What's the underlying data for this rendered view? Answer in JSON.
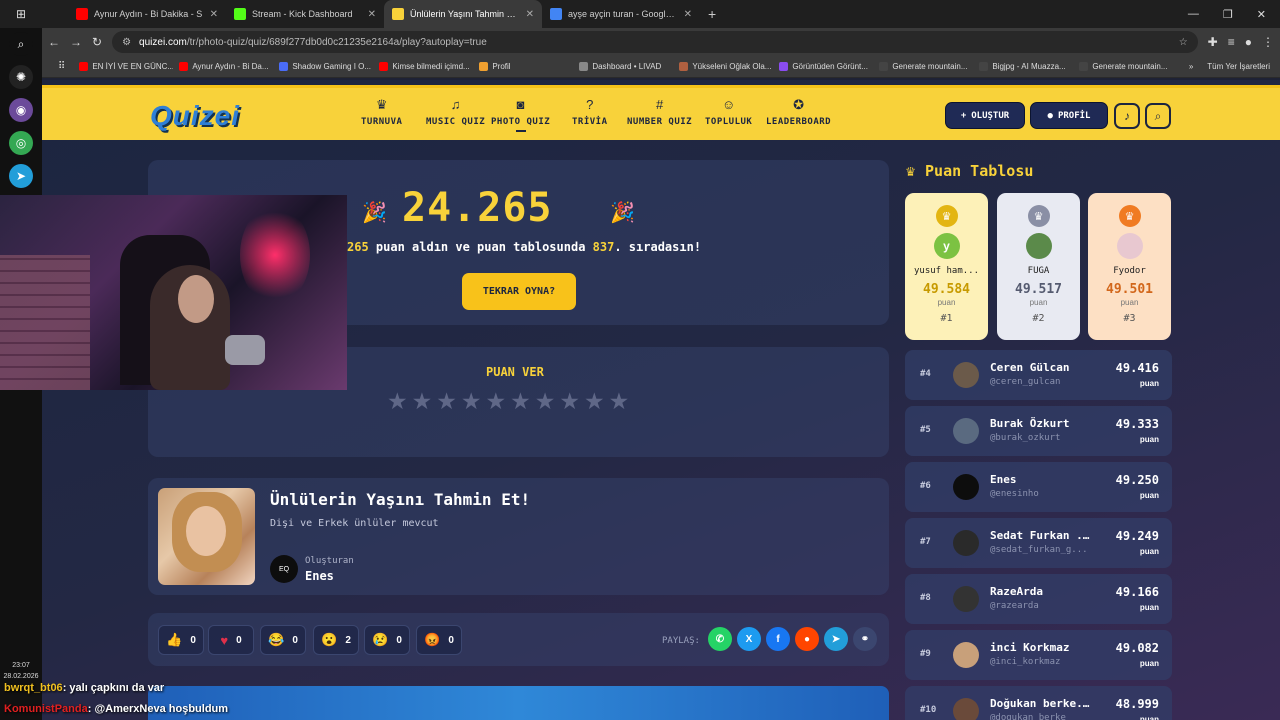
{
  "browser": {
    "tabs": [
      {
        "title": "Aynur Aydın - Bi Dakika - S",
        "color": "#ff0000",
        "active": false
      },
      {
        "title": "Stream - Kick Dashboard",
        "color": "#53fc18",
        "active": false
      },
      {
        "title": "Ünlülerin Yaşını Tahmin Et! - Qu",
        "color": "#f8d23a",
        "active": true
      },
      {
        "title": "ayşe ayçin turan - Google'da Ar",
        "color": "#4285f4",
        "active": false
      }
    ],
    "url_host": "quizei.com",
    "url_path": "/tr/photo-quiz/quiz/689f277db0d0c21235e2164a/play?autoplay=true",
    "bookmarks": [
      {
        "label": "EN İYİ VE EN GÜNC...",
        "color": "#ff0000"
      },
      {
        "label": "Aynur Aydın - Bi Da...",
        "color": "#ff0000"
      },
      {
        "label": "Shadow Gaming I O...",
        "color": "#4a6cf7"
      },
      {
        "label": "Kimse bilmedi içimd...",
        "color": "#ff0000"
      },
      {
        "label": "Profil",
        "color": "#f0a030"
      },
      {
        "label": "Dashboard • LIVAD",
        "color": "#888888"
      },
      {
        "label": "Yükseleni Oğlak Ola...",
        "color": "#b06040"
      },
      {
        "label": "Görüntüden Görünt...",
        "color": "#8a4cf0"
      },
      {
        "label": "Generate mountain...",
        "color": "#444444"
      },
      {
        "label": "Bigjpg - AI Muazza...",
        "color": "#444444"
      },
      {
        "label": "Generate mountain...",
        "color": "#444444"
      }
    ],
    "all_bookmarks": "Tüm Yer İşaretleri"
  },
  "taskbar": {
    "time": "23:07",
    "date": "28.02.2026"
  },
  "site": {
    "logo": "Quizei",
    "nav": [
      {
        "label": "TURNUVA",
        "icon": "trophy-icon",
        "glyph": "♛",
        "selected": false
      },
      {
        "label": "MUSIC QUIZ",
        "icon": "music-icon",
        "glyph": "♫",
        "selected": false
      },
      {
        "label": "PHOTO QUIZ",
        "icon": "camera-icon",
        "glyph": "◙",
        "selected": true
      },
      {
        "label": "TRİVİA",
        "icon": "question-icon",
        "glyph": "?",
        "selected": false
      },
      {
        "label": "NUMBER QUIZ",
        "icon": "hash-icon",
        "glyph": "#",
        "selected": false
      },
      {
        "label": "TOPLULUK",
        "icon": "users-icon",
        "glyph": "☺",
        "selected": false
      },
      {
        "label": "LEADERBOARD",
        "icon": "award-icon",
        "glyph": "✪",
        "selected": false
      }
    ],
    "create_label": "OLUŞTUR",
    "profile_label": "PROFİL"
  },
  "result": {
    "score": "24.265",
    "line_prefix": "265",
    "line_mid": " puan aldın ve puan tablosunda ",
    "rank": "837",
    "line_suffix": ". sıradasın!",
    "replay_label": "TEKRAR OYNA?"
  },
  "rating": {
    "title": "PUAN VER",
    "stars": 10
  },
  "quiz": {
    "title": "Ünlülerin Yaşını Tahmin Et!",
    "description": "Dişi ve Erkek ünlüler mevcut",
    "creator_label": "Oluşturan",
    "creator_name": "Enes"
  },
  "reactions": [
    {
      "emoji": "👍",
      "count": "0"
    },
    {
      "emoji": "♥",
      "count": "0"
    },
    {
      "emoji": "😂",
      "count": "0"
    },
    {
      "emoji": "😮",
      "count": "2"
    },
    {
      "emoji": "😢",
      "count": "0"
    },
    {
      "emoji": "😡",
      "count": "0"
    }
  ],
  "share": {
    "label": "PAYLAŞ:",
    "buttons": [
      {
        "name": "whatsapp",
        "glyph": "✆",
        "color": "#25d366"
      },
      {
        "name": "x",
        "glyph": "X",
        "color": "#1d9bf0"
      },
      {
        "name": "facebook",
        "glyph": "f",
        "color": "#1877f2"
      },
      {
        "name": "reddit",
        "glyph": "●",
        "color": "#ff4500"
      },
      {
        "name": "telegram",
        "glyph": "➤",
        "color": "#229ed9"
      },
      {
        "name": "copy-link",
        "glyph": "⚭",
        "color": "#3b466f"
      }
    ]
  },
  "leaderboard": {
    "title": "Puan Tablosu",
    "top3": [
      {
        "name": "yusuf ham...",
        "score": "49.584",
        "unit": "puan",
        "rank": "#1",
        "bg": "#fdf1b8",
        "medal": "#e3b512",
        "avatar_letter": "y",
        "avatar_bg": "#7cc242",
        "score_color": "#c79a00"
      },
      {
        "name": "FUGA",
        "score": "49.517",
        "unit": "puan",
        "rank": "#2",
        "bg": "#e8eaf2",
        "medal": "#8a8fa5",
        "avatar_letter": "",
        "avatar_bg": "#5b8a4a",
        "score_color": "#555b70"
      },
      {
        "name": "Fyodor",
        "score": "49.501",
        "unit": "puan",
        "rank": "#3",
        "bg": "#fde0c4",
        "medal": "#f07b22",
        "avatar_letter": "",
        "avatar_bg": "#e8c8d0",
        "score_color": "#d2661a"
      }
    ],
    "rows": [
      {
        "rank": "#4",
        "name": "Ceren Gülcan",
        "handle": "@ceren_gulcan",
        "score": "49.416",
        "unit": "puan",
        "avatar": "#6b5a4a"
      },
      {
        "rank": "#5",
        "name": "Burak Özkurt",
        "handle": "@burak_ozkurt",
        "score": "49.333",
        "unit": "puan",
        "avatar": "#5a6a80"
      },
      {
        "rank": "#6",
        "name": "Enes",
        "handle": "@enesinho",
        "score": "49.250",
        "unit": "puan",
        "avatar": "#0d0d0d"
      },
      {
        "rank": "#7",
        "name": "Sedat Furkan ...",
        "handle": "@sedat_furkan_g...",
        "score": "49.249",
        "unit": "puan",
        "avatar": "#2a2a2a"
      },
      {
        "rank": "#8",
        "name": "RazeArda",
        "handle": "@razearda",
        "score": "49.166",
        "unit": "puan",
        "avatar": "#333333"
      },
      {
        "rank": "#9",
        "name": "inci Korkmaz",
        "handle": "@inci_korkmaz",
        "score": "49.082",
        "unit": "puan",
        "avatar": "#c8a07a"
      },
      {
        "rank": "#10",
        "name": "Doğukan berke...",
        "handle": "@dogukan_berke",
        "score": "48.999",
        "unit": "puan",
        "avatar": "#6a4a3a"
      }
    ]
  },
  "chat": [
    {
      "user": "bwrqt_bt06",
      "user_color": "#f0c020",
      "text": ": yalı çapkını da var"
    },
    {
      "user": "KomunistPanda",
      "user_color": "#e02020",
      "text": ": @AmerxNeva hoşbuldum"
    }
  ]
}
